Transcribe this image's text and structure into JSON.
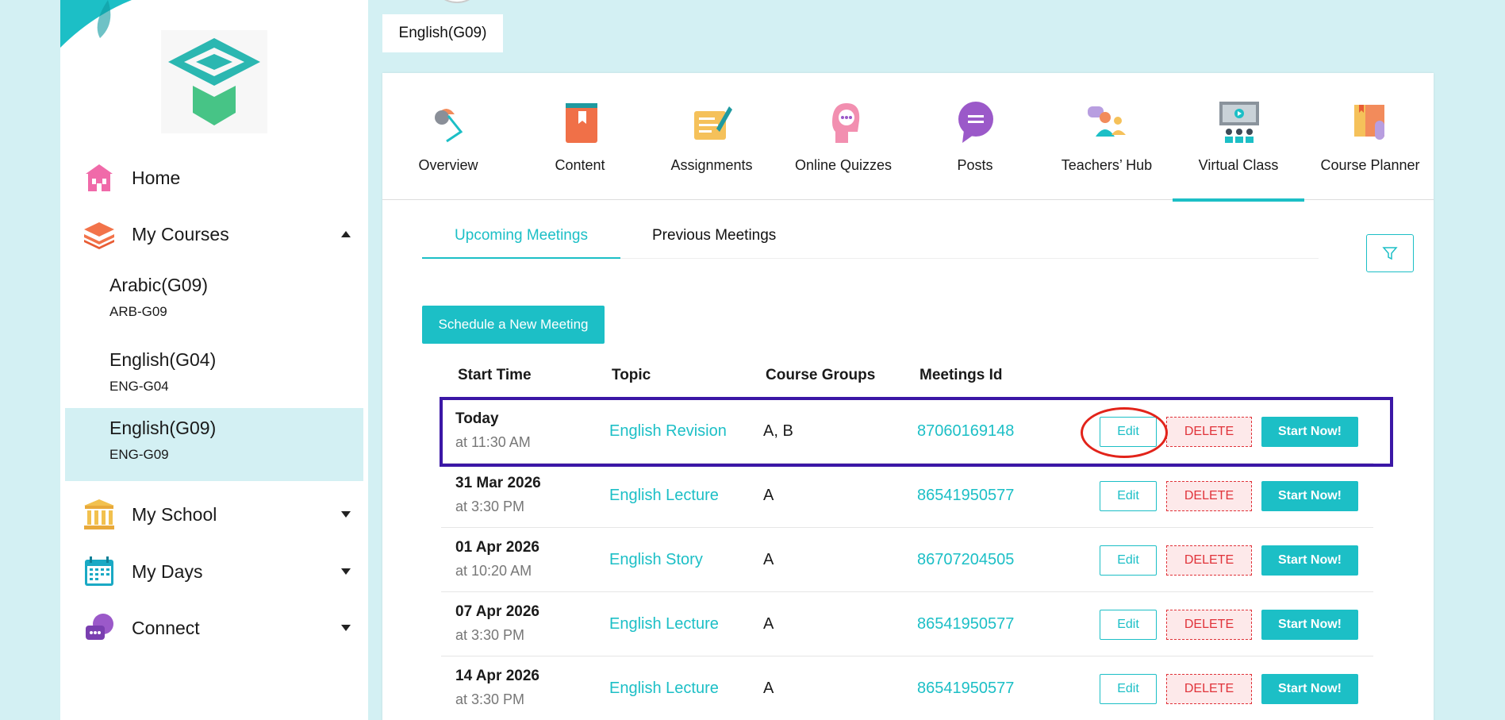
{
  "breadcrumb": {
    "course": "English(G09)"
  },
  "sidebar": {
    "logo": "eduflag-logo",
    "nav": [
      {
        "label": "Home",
        "icon": "home-icon"
      },
      {
        "label": "My Courses",
        "icon": "courses-stack-icon",
        "expanded": true
      },
      {
        "label": "My School",
        "icon": "school-icon",
        "expanded": false
      },
      {
        "label": "My Days",
        "icon": "calendar-icon",
        "expanded": false
      },
      {
        "label": "Connect",
        "icon": "connect-chat-icon",
        "expanded": false
      }
    ],
    "courses": [
      {
        "name": "Arabic(G09)",
        "code": "ARB-G09"
      },
      {
        "name": "English(G04)",
        "code": "ENG-G04"
      },
      {
        "name": "English(G09)",
        "code": "ENG-G09",
        "active": true
      }
    ]
  },
  "tools": [
    {
      "label": "Overview",
      "icon": "overview-lamp-icon"
    },
    {
      "label": "Content",
      "icon": "book-icon"
    },
    {
      "label": "Assignments",
      "icon": "assignment-pen-icon"
    },
    {
      "label": "Online Quizzes",
      "icon": "quiz-head-icon"
    },
    {
      "label": "Posts",
      "icon": "speech-bubble-icon"
    },
    {
      "label": "Teachers’ Hub",
      "icon": "teachers-hub-icon"
    },
    {
      "label": "Virtual Class",
      "icon": "virtual-class-icon",
      "active": true
    },
    {
      "label": "Course Planner",
      "icon": "planner-binder-icon"
    }
  ],
  "subtabs": {
    "upcoming": "Upcoming Meetings",
    "previous": "Previous Meetings"
  },
  "schedule_button": "Schedule a New Meeting",
  "table": {
    "headers": {
      "start": "Start Time",
      "topic": "Topic",
      "groups": "Course Groups",
      "id": "Meetings Id"
    },
    "rows": [
      {
        "date": "Today",
        "time": "at 11:30 AM",
        "topic": "English Revision",
        "groups": "A, B",
        "id": "87060169148"
      },
      {
        "date": "31 Mar 2026",
        "time": "at 3:30 PM",
        "topic": "English Lecture",
        "groups": "A",
        "id": "86541950577"
      },
      {
        "date": "01 Apr 2026",
        "time": "at 10:20 AM",
        "topic": "English Story",
        "groups": "A",
        "id": "86707204505"
      },
      {
        "date": "07 Apr 2026",
        "time": "at 3:30 PM",
        "topic": "English Lecture",
        "groups": "A",
        "id": "86541950577"
      },
      {
        "date": "14 Apr 2026",
        "time": "at 3:30 PM",
        "topic": "English Lecture",
        "groups": "A",
        "id": "86541950577"
      }
    ],
    "actions": {
      "edit": "Edit",
      "delete": "DELETE",
      "start": "Start Now!"
    }
  },
  "colors": {
    "accent": "#1cbfc6",
    "highlight": "#3b17a6",
    "annotation": "#e2231a",
    "danger": "#e0333a"
  }
}
